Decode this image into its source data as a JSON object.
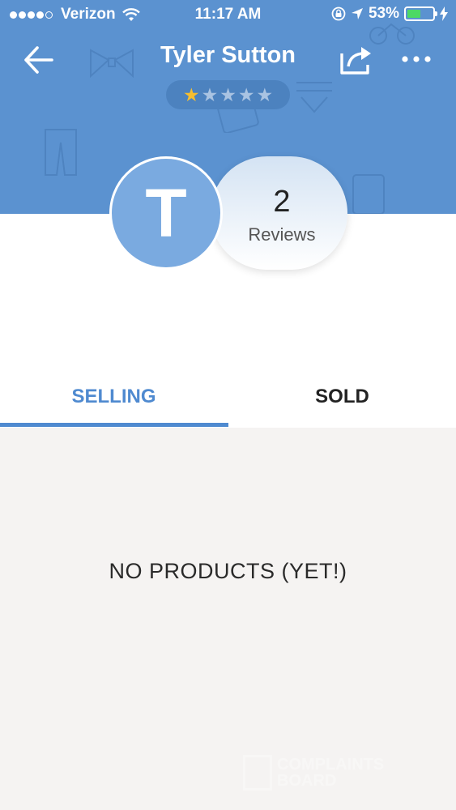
{
  "status_bar": {
    "carrier": "Verizon",
    "time": "11:17 AM",
    "battery_percent": "53%",
    "signal_bars": 4,
    "signal_total": 5
  },
  "header": {
    "title": "Tyler Sutton",
    "rating": 1,
    "rating_max": 5,
    "icons": [
      "back-arrow-icon",
      "share-icon",
      "more-icon"
    ]
  },
  "profile": {
    "avatar_initial": "T",
    "reviews_count": "2",
    "reviews_label": "Reviews"
  },
  "tabs": [
    {
      "label": "SELLING",
      "active": true
    },
    {
      "label": "SOLD",
      "active": false
    }
  ],
  "content": {
    "empty_message": "NO PRODUCTS (YET!)"
  },
  "watermark": {
    "line1": "COMPLAINTS",
    "line2": "BOARD"
  },
  "colors": {
    "header_blue": "#5b92d0",
    "accent_blue": "#4f8ad0",
    "avatar_blue": "#7aaae0",
    "star_gold": "#f6be2f",
    "content_bg": "#f5f3f2"
  }
}
